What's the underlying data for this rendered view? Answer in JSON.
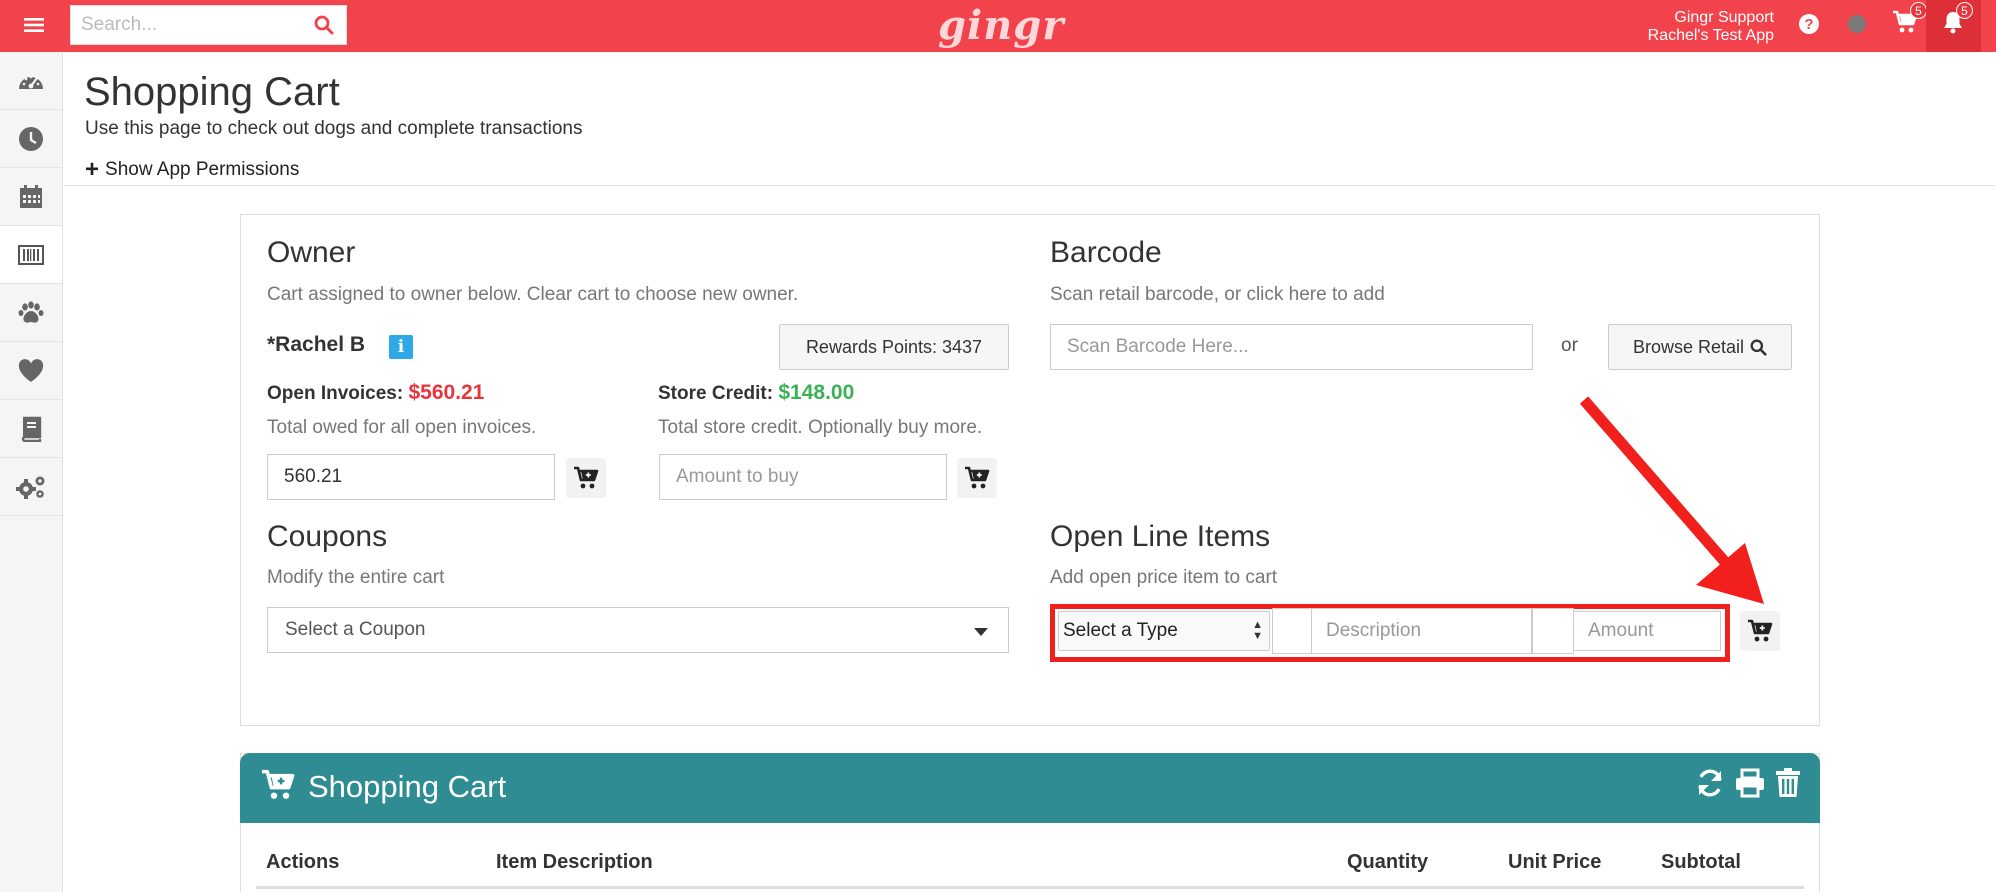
{
  "topbar": {
    "search_placeholder": "Search...",
    "logo": "gingr",
    "user_name": "Gingr Support",
    "app_name": "Rachel's Test App",
    "cart_count": "5",
    "notification_count": "5"
  },
  "sidebar": {
    "items": [
      {
        "icon": "dashboard-icon"
      },
      {
        "icon": "clock-icon"
      },
      {
        "icon": "calendar-icon"
      },
      {
        "icon": "barcode-icon"
      },
      {
        "icon": "paw-icon"
      },
      {
        "icon": "heart-icon"
      },
      {
        "icon": "book-icon"
      },
      {
        "icon": "gears-icon"
      }
    ]
  },
  "page": {
    "title": "Shopping Cart",
    "subtitle": "Use this page to check out dogs and complete transactions",
    "permissions_link": "Show App Permissions"
  },
  "owner": {
    "title": "Owner",
    "subtitle": "Cart assigned to owner below. Clear cart to choose new owner.",
    "name": "*Rachel B",
    "info_icon": "i",
    "rewards_button": "Rewards Points: 3437",
    "open_invoices_label": "Open Invoices:",
    "open_invoices_value": "$560.21",
    "open_invoices_help": "Total owed for all open invoices.",
    "invoice_amount": "560.21",
    "store_credit_label": "Store Credit:",
    "store_credit_value": "$148.00",
    "store_credit_help": "Total store credit. Optionally buy more.",
    "amount_to_buy_placeholder": "Amount to buy"
  },
  "barcode": {
    "title": "Barcode",
    "subtitle": "Scan retail barcode, or click here to add",
    "placeholder": "Scan Barcode Here...",
    "or_text": "or",
    "browse_button": "Browse Retail"
  },
  "coupons": {
    "title": "Coupons",
    "subtitle": "Modify the entire cart",
    "select_value": "Select a Coupon"
  },
  "open_line_items": {
    "title": "Open Line Items",
    "subtitle": "Add open price item to cart",
    "type_select": "Select a Type",
    "description_placeholder": "Description",
    "amount_placeholder": "Amount"
  },
  "cart": {
    "title": "Shopping Cart",
    "columns": [
      "Actions",
      "Item Description",
      "Quantity",
      "Unit Price",
      "Subtotal"
    ]
  },
  "colors": {
    "brand_red": "#f2434c",
    "teal": "#2e8c92",
    "annotation_red": "#f2201d",
    "money_red": "#e8353d",
    "money_green": "#3bb157"
  }
}
